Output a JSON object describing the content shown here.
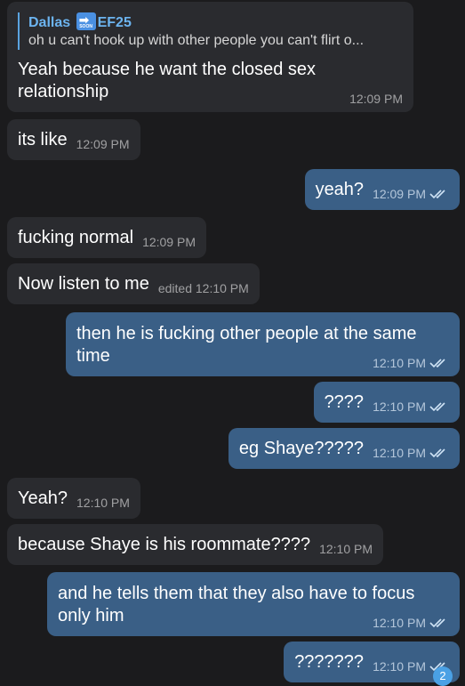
{
  "messages": [
    {
      "reply_name_prefix": "Dallas",
      "reply_name_suffix": "EF25",
      "reply_text": "oh u can't hook up with other people you can't flirt o...",
      "text": "Yeah because he want the closed sex\nrelationship",
      "time": "12:09 PM"
    },
    {
      "text": "its like",
      "time": "12:09 PM"
    },
    {
      "text": "yeah?",
      "time": "12:09 PM"
    },
    {
      "text": "fucking normal",
      "time": "12:09 PM"
    },
    {
      "text": "Now listen to me",
      "time": "edited 12:10 PM"
    },
    {
      "text": "then he is fucking other people at the same\ntime",
      "time": "12:10 PM"
    },
    {
      "text": "????",
      "time": "12:10 PM"
    },
    {
      "text": "eg Shaye?????",
      "time": "12:10 PM"
    },
    {
      "text": "Yeah?",
      "time": "12:10 PM"
    },
    {
      "text": "because Shaye is his roommate????",
      "time": "12:10 PM"
    },
    {
      "text": "and he tells them that they also have to focus\nonly him",
      "time": "12:10 PM"
    },
    {
      "text": "???????",
      "time": "12:10 PM"
    }
  ],
  "soon_emoji": {
    "label": "SOON",
    "arrow": "➡"
  },
  "unread_badge": "2",
  "colors": {
    "background": "#1b1b1d",
    "incoming": "#2a2b2f",
    "outgoing": "#3a5f86",
    "accent": "#6cb4f0"
  }
}
